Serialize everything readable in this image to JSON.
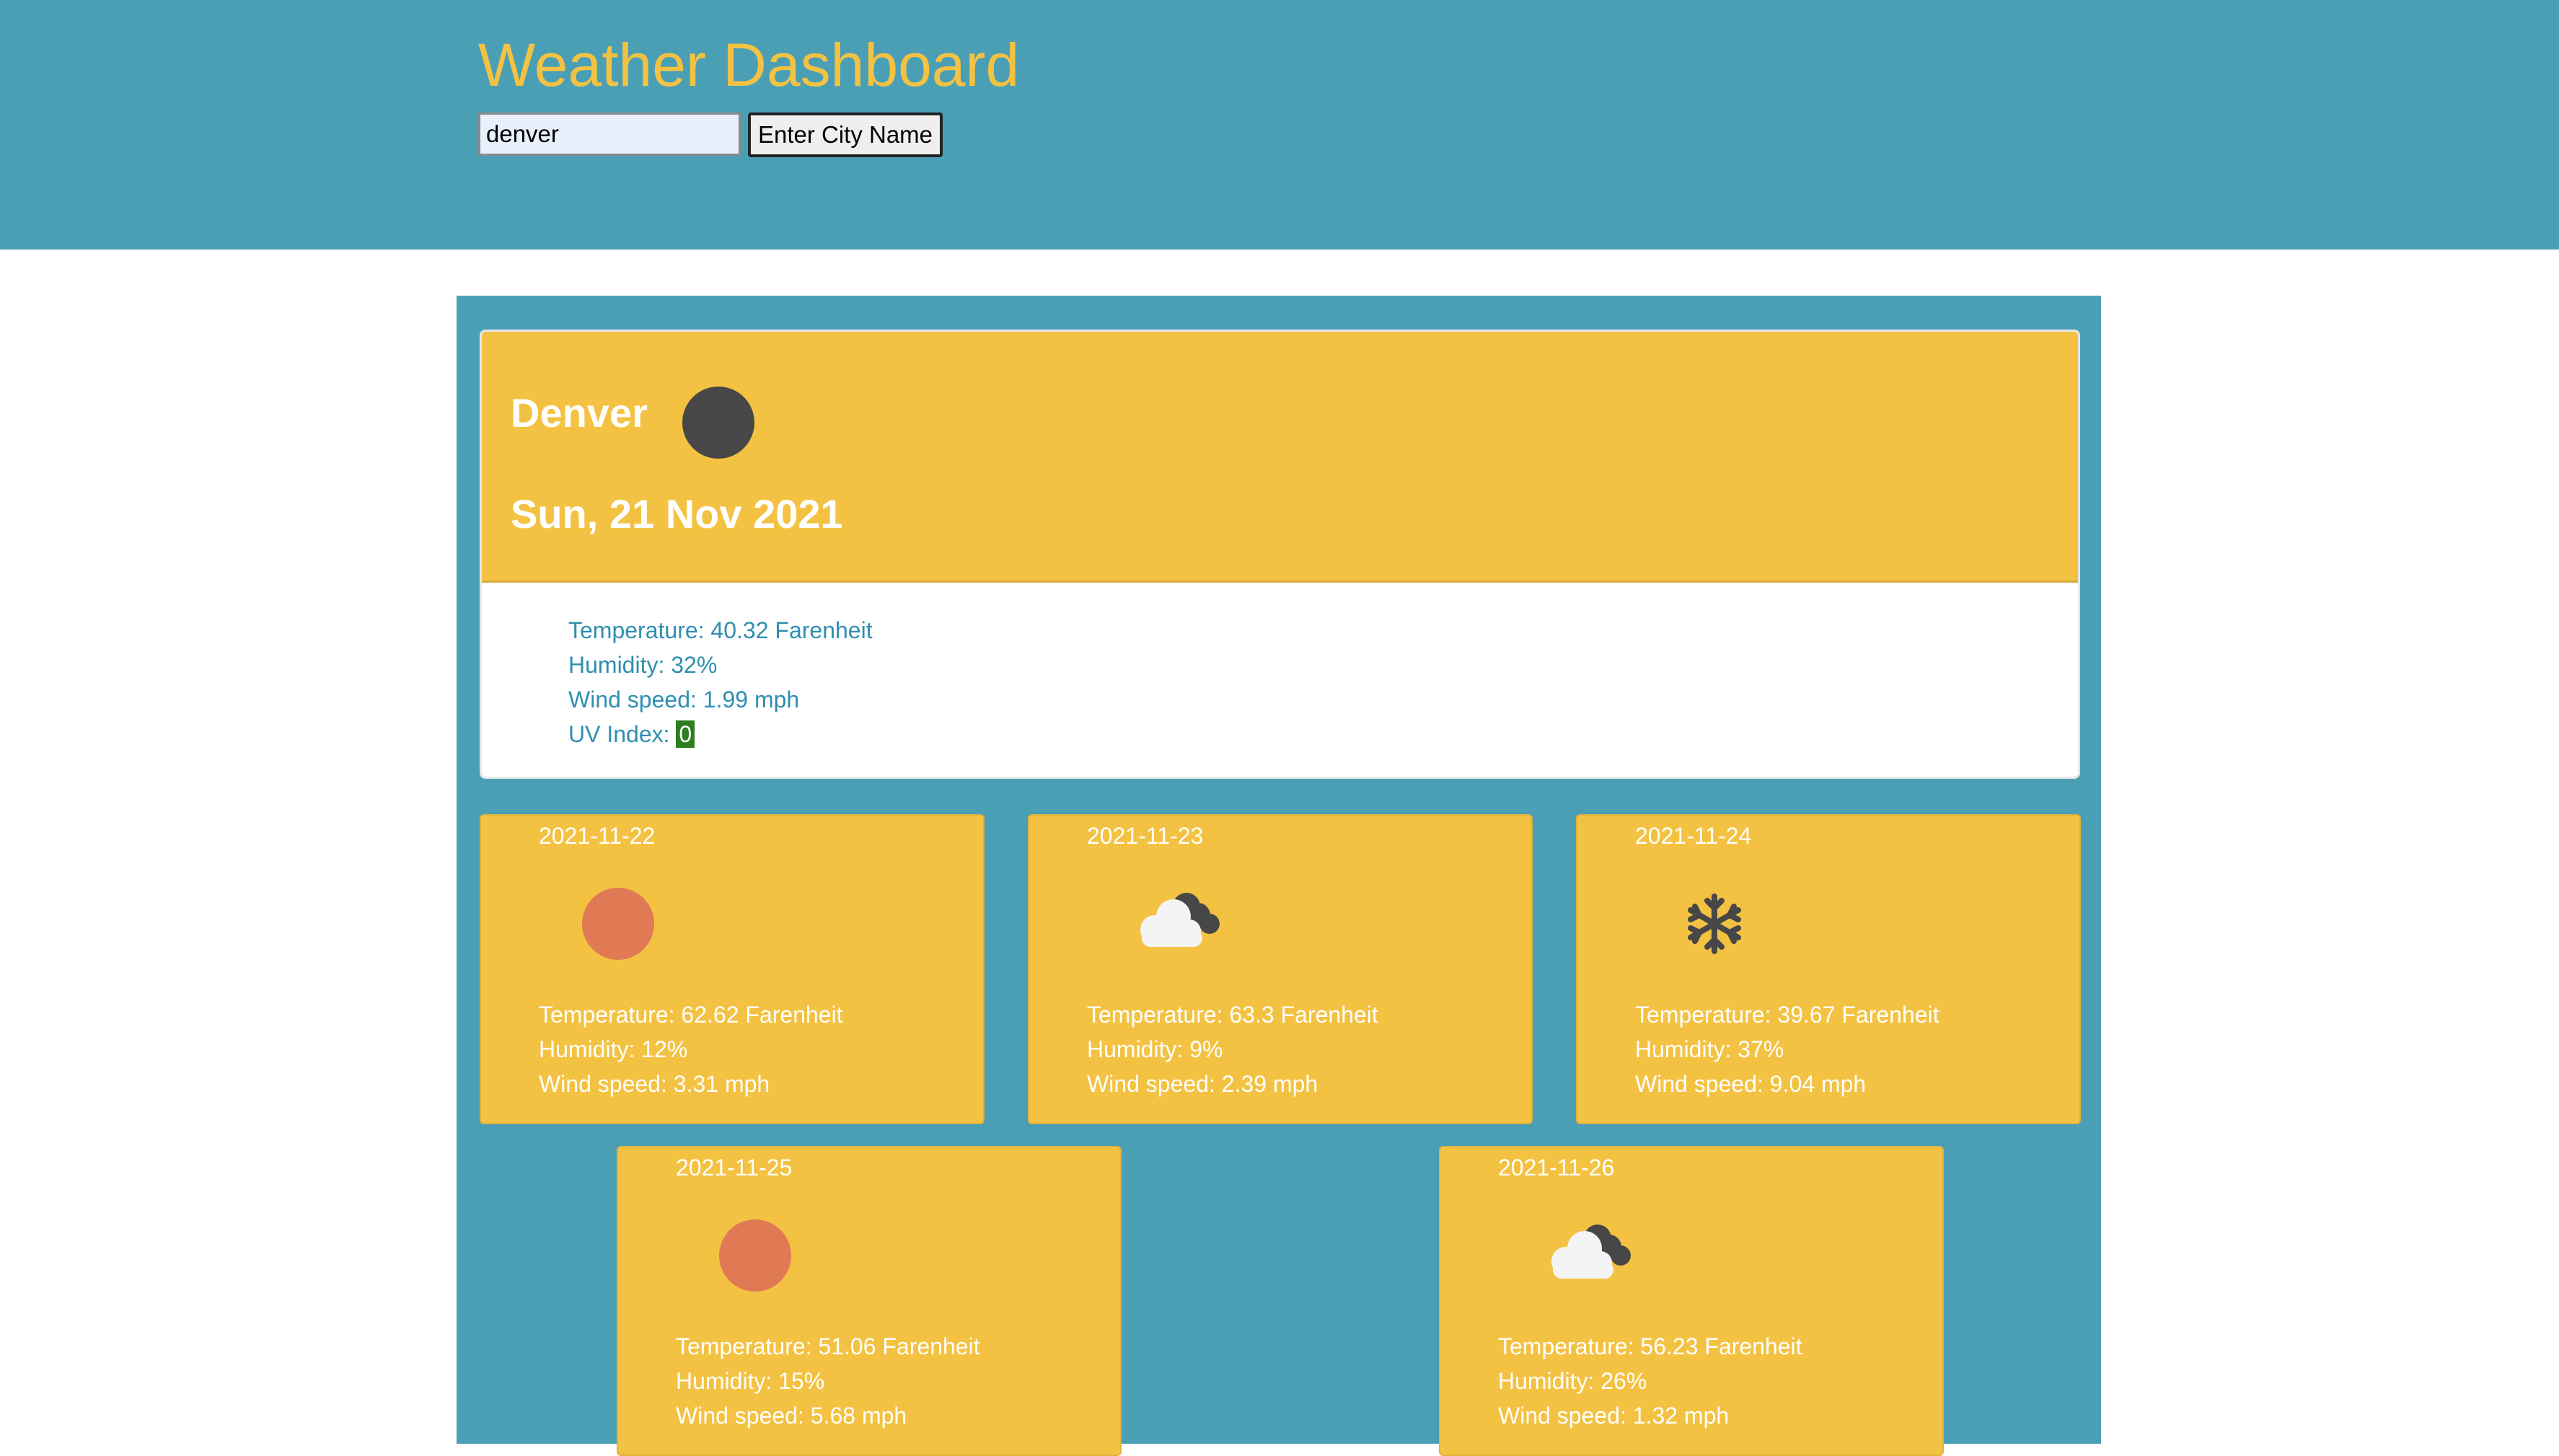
{
  "header": {
    "title": "Weather Dashboard",
    "search_value": "denver",
    "search_button_label": "Enter City Name"
  },
  "current": {
    "city": "Denver",
    "icon": "moon-icon",
    "date": "Sun, 21 Nov 2021",
    "temperature": "Temperature: 40.32 Farenheit",
    "humidity": "Humidity: 32%",
    "wind": "Wind speed: 1.99 mph",
    "uv_label": "UV Index: ",
    "uv_value": "0",
    "uv_color": "#2e7d1e"
  },
  "forecast": [
    {
      "date": "2021-11-22",
      "icon": "sun-icon",
      "temperature": "Temperature: 62.62 Farenheit",
      "humidity": "Humidity: 12%",
      "wind": "Wind speed: 3.31 mph"
    },
    {
      "date": "2021-11-23",
      "icon": "cloud-icon",
      "temperature": "Temperature: 63.3 Farenheit",
      "humidity": "Humidity: 9%",
      "wind": "Wind speed: 2.39 mph"
    },
    {
      "date": "2021-11-24",
      "icon": "snowflake-icon",
      "temperature": "Temperature: 39.67 Farenheit",
      "humidity": "Humidity: 37%",
      "wind": "Wind speed: 9.04 mph"
    },
    {
      "date": "2021-11-25",
      "icon": "sun-icon",
      "temperature": "Temperature: 51.06 Farenheit",
      "humidity": "Humidity: 15%",
      "wind": "Wind speed: 5.68 mph"
    },
    {
      "date": "2021-11-26",
      "icon": "cloud-icon",
      "temperature": "Temperature: 56.23 Farenheit",
      "humidity": "Humidity: 26%",
      "wind": "Wind speed: 1.32 mph"
    }
  ],
  "colors": {
    "header_bg": "#4b9fb5",
    "accent": "#f4c242",
    "detail_text": "#2f8fb0"
  }
}
